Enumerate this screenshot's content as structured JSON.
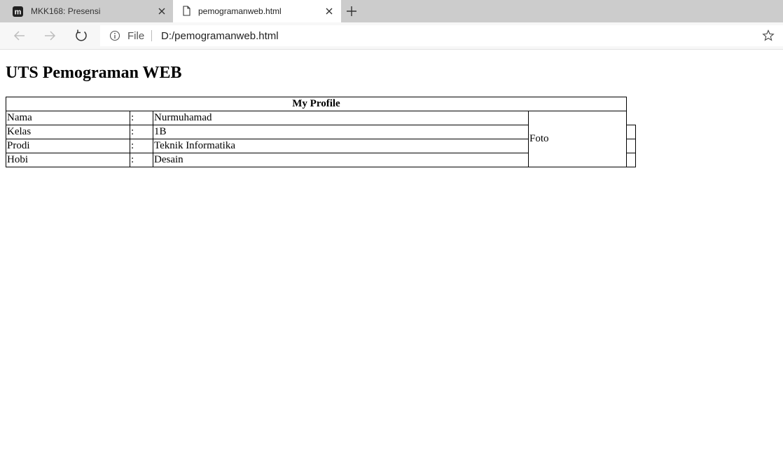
{
  "browser": {
    "tabs": [
      {
        "title": "MKK168: Presensi",
        "active": false,
        "favicon": "moodle-m-icon"
      },
      {
        "title": "pemogramanweb.html",
        "active": true,
        "favicon": "file-page-icon"
      }
    ],
    "address": {
      "scheme_label": "File",
      "url": "D:/pemogramanweb.html"
    }
  },
  "page": {
    "heading": "UTS Pemograman WEB",
    "table": {
      "caption": "My Profile",
      "photo_label": "Foto",
      "rows": [
        {
          "label": "Nama",
          "sep": ":",
          "value": "Nurmuhamad"
        },
        {
          "label": "Kelas",
          "sep": ":",
          "value": "1B"
        },
        {
          "label": "Prodi",
          "sep": ":",
          "value": "Teknik Informatika"
        },
        {
          "label": "Hobi",
          "sep": ":",
          "value": "Desain"
        }
      ]
    }
  }
}
